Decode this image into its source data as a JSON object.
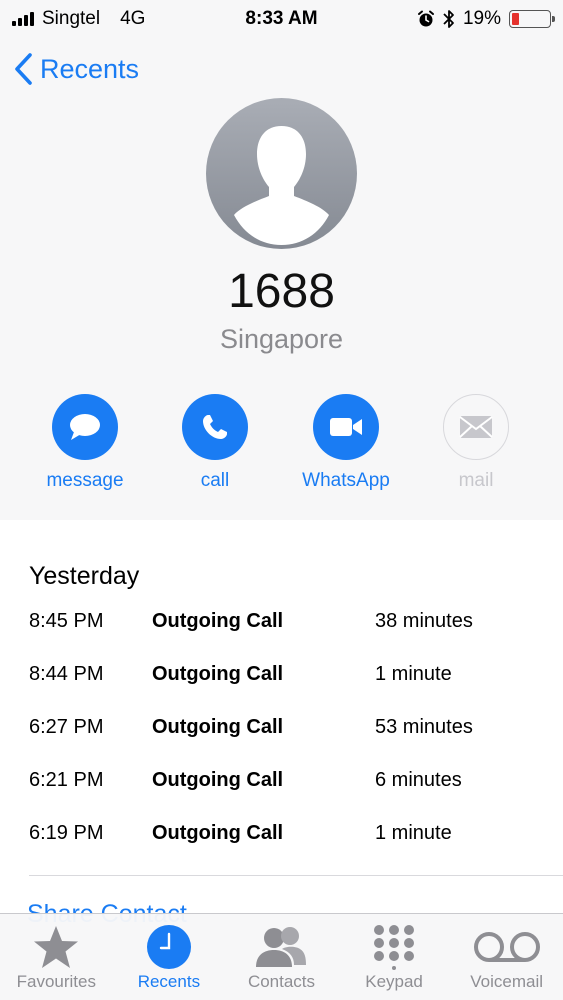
{
  "status_bar": {
    "carrier": "Singtel",
    "network": "4G",
    "time": "8:33 AM",
    "battery_percent": "19%",
    "battery_level": 0.19,
    "battery_color": "#e5322d"
  },
  "nav": {
    "back_label": "Recents"
  },
  "contact": {
    "number": "1688",
    "location": "Singapore"
  },
  "actions": [
    {
      "label": "message",
      "icon": "message-bubble-icon",
      "enabled": true
    },
    {
      "label": "call",
      "icon": "phone-icon",
      "enabled": true
    },
    {
      "label": "WhatsApp",
      "icon": "video-camera-icon",
      "enabled": true
    },
    {
      "label": "mail",
      "icon": "envelope-icon",
      "enabled": false
    }
  ],
  "call_log": {
    "day": "Yesterday",
    "calls": [
      {
        "time": "8:45 PM",
        "type": "Outgoing Call",
        "duration": "38 minutes"
      },
      {
        "time": "8:44 PM",
        "type": "Outgoing Call",
        "duration": "1 minute"
      },
      {
        "time": "6:27 PM",
        "type": "Outgoing Call",
        "duration": "53 minutes"
      },
      {
        "time": "6:21 PM",
        "type": "Outgoing Call",
        "duration": "6 minutes"
      },
      {
        "time": "6:19 PM",
        "type": "Outgoing Call",
        "duration": "1 minute"
      }
    ],
    "share_contact": "Share Contact"
  },
  "tab_bar": {
    "tabs": [
      {
        "label": "Favourites",
        "icon": "star-icon",
        "active": false
      },
      {
        "label": "Recents",
        "icon": "clock-icon",
        "active": true
      },
      {
        "label": "Contacts",
        "icon": "contacts-icon",
        "active": false
      },
      {
        "label": "Keypad",
        "icon": "keypad-icon",
        "active": false
      },
      {
        "label": "Voicemail",
        "icon": "voicemail-icon",
        "active": false
      }
    ]
  },
  "colors": {
    "accent": "#1a7cf3",
    "disabled": "#c7c7cc",
    "secondary_text": "#8a8a8e"
  }
}
